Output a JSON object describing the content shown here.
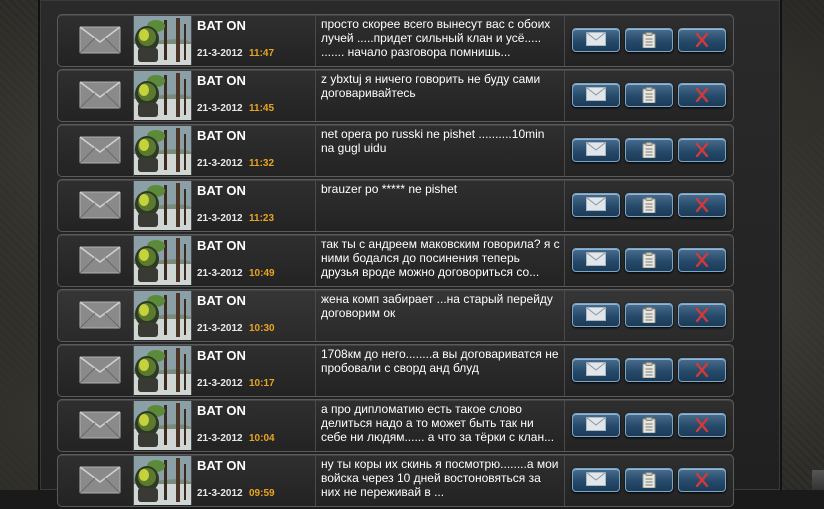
{
  "messages": [
    {
      "sender": "BAT ON",
      "date": "21-3-2012",
      "time": "11:47",
      "text": "просто скорее всего вынесут вас с обоих лучей .....придет сильный клан и усё..... ....... начало разговора помнишь..."
    },
    {
      "sender": "BAT ON",
      "date": "21-3-2012",
      "time": "11:45",
      "text": "z ybxtuj  я ничего говорить не буду сами договаривайтесь"
    },
    {
      "sender": "BAT ON",
      "date": "21-3-2012",
      "time": "11:32",
      "text": "net  opera po russki ne pishet ..........10min na  gugl uidu"
    },
    {
      "sender": "BAT ON",
      "date": "21-3-2012",
      "time": "11:23",
      "text": "brauzer po ***** ne pishet"
    },
    {
      "sender": "BAT ON",
      "date": "21-3-2012",
      "time": "10:49",
      "text": "так ты с андреем маковским говорила? я с ними бодался до посинения  теперь друзья  вроде можно договориться со..."
    },
    {
      "sender": "BAT ON",
      "date": "21-3-2012",
      "time": "10:30",
      "text": "жена комп забирает ...на старый перейду договорим   ок"
    },
    {
      "sender": "BAT ON",
      "date": "21-3-2012",
      "time": "10:17",
      "text": "1708км до него........а вы договариватся не пробовали с  сворд анд блуд"
    },
    {
      "sender": "BAT ON",
      "date": "21-3-2012",
      "time": "10:04",
      "text": "а про дипломатию   есть такое слово делиться надо  а то может быть так ни себе ни людям...... а что за тёрки с клан..."
    },
    {
      "sender": "BAT ON",
      "date": "21-3-2012",
      "time": "09:59",
      "text": "ну ты коры их скинь я посмотрю........а мои войска через 10 дней востоновяться за них не переживай в ..."
    }
  ],
  "icons": {
    "envelope": "envelope-icon",
    "reply": "reply-envelope-icon",
    "copy": "clipboard-icon",
    "delete": "delete-x-icon"
  },
  "colors": {
    "time": "#e8a423",
    "button": "#264a6a",
    "delete_x": "#d23a3a"
  }
}
